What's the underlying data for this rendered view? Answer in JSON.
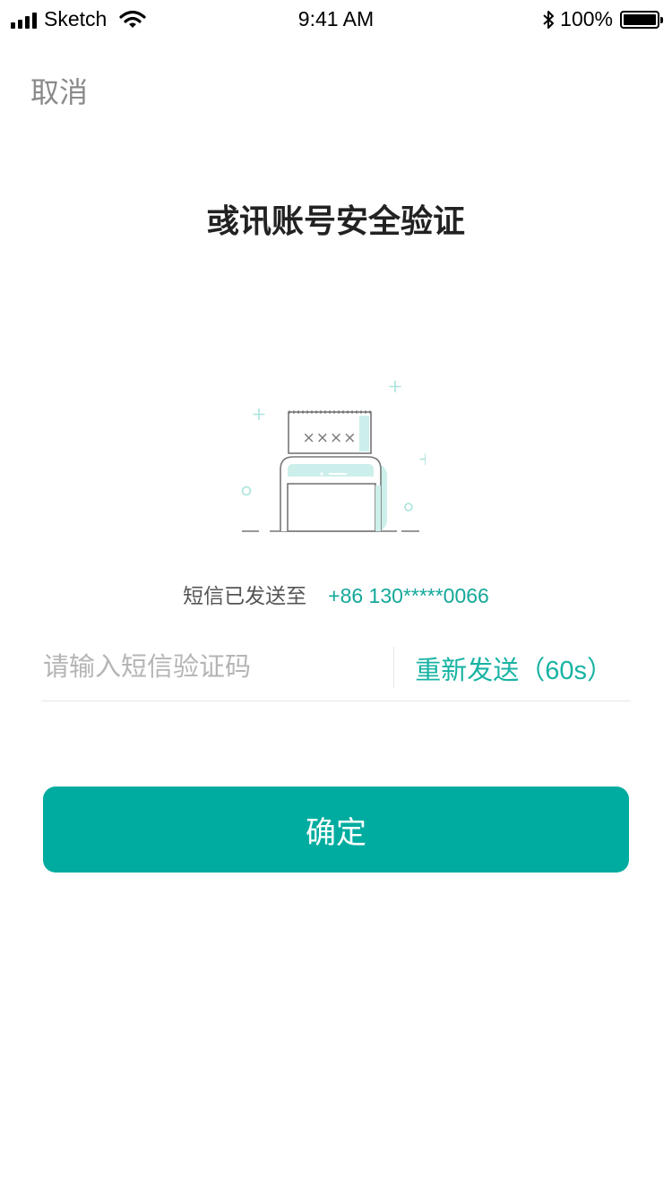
{
  "status_bar": {
    "carrier": "Sketch",
    "time": "9:41 AM",
    "battery": "100%",
    "icons": [
      "signal-icon",
      "wifi-icon",
      "bluetooth-icon",
      "battery-icon"
    ]
  },
  "nav": {
    "cancel_label": "取消"
  },
  "page": {
    "title": "彧讯账号安全验证"
  },
  "illustration": {
    "icon": "sms-phone-illustration",
    "code_text": "××××"
  },
  "sms_info": {
    "label": "短信已发送至",
    "phone": "+86 130*****0066"
  },
  "code_input": {
    "value": "",
    "placeholder": "请输入短信验证码"
  },
  "resend": {
    "label": "重新发送（60s）"
  },
  "confirm": {
    "label": "确定"
  },
  "colors": {
    "accent": "#00ac9f",
    "accent_text": "#17b3a3",
    "placeholder": "#b5b5b5",
    "muted": "#8a8a8a"
  }
}
